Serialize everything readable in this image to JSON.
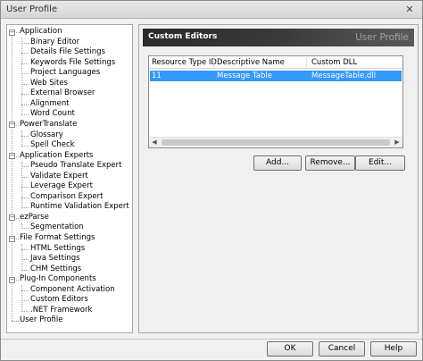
{
  "window": {
    "title": "User Profile",
    "close_glyph": "✕"
  },
  "tree": {
    "items": [
      {
        "label": "Application",
        "level": 0,
        "expandable": true
      },
      {
        "label": "Binary Editor",
        "level": 1
      },
      {
        "label": "Details File Settings",
        "level": 1
      },
      {
        "label": "Keywords File Settings",
        "level": 1
      },
      {
        "label": "Project Languages",
        "level": 1
      },
      {
        "label": "Web Sites",
        "level": 1
      },
      {
        "label": "External Browser",
        "level": 1
      },
      {
        "label": "Alignment",
        "level": 1
      },
      {
        "label": "Word Count",
        "level": 1
      },
      {
        "label": "PowerTranslate",
        "level": 0,
        "expandable": true
      },
      {
        "label": "Glossary",
        "level": 1
      },
      {
        "label": "Spell Check",
        "level": 1
      },
      {
        "label": "Application Experts",
        "level": 0,
        "expandable": true
      },
      {
        "label": "Pseudo Translate Expert",
        "level": 1
      },
      {
        "label": "Validate Expert",
        "level": 1
      },
      {
        "label": "Leverage Expert",
        "level": 1
      },
      {
        "label": "Comparison Expert",
        "level": 1
      },
      {
        "label": "Runtime Validation Expert",
        "level": 1
      },
      {
        "label": "ezParse",
        "level": 0,
        "expandable": true
      },
      {
        "label": "Segmentation",
        "level": 1
      },
      {
        "label": "File Format Settings",
        "level": 0,
        "expandable": true
      },
      {
        "label": "HTML Settings",
        "level": 1
      },
      {
        "label": "Java Settings",
        "level": 1
      },
      {
        "label": "CHM Settings",
        "level": 1
      },
      {
        "label": "Plug-In Components",
        "level": 0,
        "expandable": true
      },
      {
        "label": "Component Activation",
        "level": 1
      },
      {
        "label": "Custom Editors",
        "level": 1
      },
      {
        "label": ".NET Framework",
        "level": 1
      },
      {
        "label": "User Profile",
        "level": 0
      }
    ]
  },
  "panel": {
    "title": "Custom Editors",
    "subtitle": "User Profile",
    "columns": [
      "Resource Type ID",
      "Descriptive Name",
      "Custom DLL"
    ],
    "rows": [
      {
        "cells": [
          "11",
          "Message Table",
          "MessageTable.dll"
        ],
        "selected": true
      }
    ],
    "scroll_left": "◀",
    "scroll_right": "▶",
    "buttons": {
      "add": "Add...",
      "remove": "Remove...",
      "edit": "Edit..."
    }
  },
  "footer": {
    "ok": "OK",
    "cancel": "Cancel",
    "help": "Help"
  },
  "colors": {
    "selection": "#3399ff",
    "header_bg": "#2b2b2b",
    "header_sub": "#a0a0a0"
  }
}
